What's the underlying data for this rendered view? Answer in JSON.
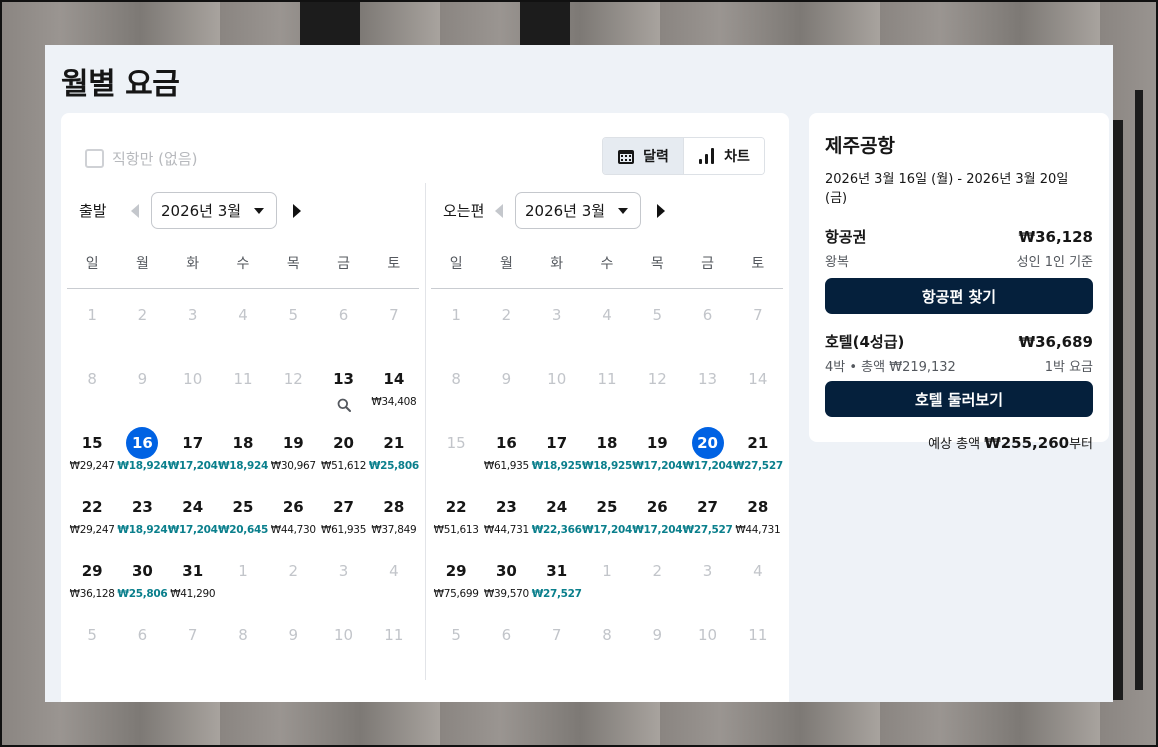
{
  "page_title": "월별 요금",
  "direct_only_label": "직항만 (없음)",
  "view_toggle": {
    "calendar": "달력",
    "chart": "차트",
    "active": "calendar"
  },
  "weekdays": [
    "일",
    "월",
    "화",
    "수",
    "목",
    "금",
    "토"
  ],
  "departure": {
    "label": "출발",
    "month_select": "2026년 3월",
    "weeks": [
      [
        {
          "d": "1",
          "m": true
        },
        {
          "d": "2",
          "m": true
        },
        {
          "d": "3",
          "m": true
        },
        {
          "d": "4",
          "m": true
        },
        {
          "d": "5",
          "m": true
        },
        {
          "d": "6",
          "m": true
        },
        {
          "d": "7",
          "m": true
        }
      ],
      [
        {
          "d": "8",
          "m": true
        },
        {
          "d": "9",
          "m": true
        },
        {
          "d": "10",
          "m": true
        },
        {
          "d": "11",
          "m": true
        },
        {
          "d": "12",
          "m": true
        },
        {
          "d": "13",
          "search": true
        },
        {
          "d": "14",
          "p": "₩34,408"
        }
      ],
      [
        {
          "d": "15",
          "p": "₩29,247"
        },
        {
          "d": "16",
          "p": "₩18,924",
          "low": true,
          "sel": true
        },
        {
          "d": "17",
          "p": "₩17,204",
          "low": true
        },
        {
          "d": "18",
          "p": "₩18,924",
          "low": true
        },
        {
          "d": "19",
          "p": "₩30,967"
        },
        {
          "d": "20",
          "p": "₩51,612"
        },
        {
          "d": "21",
          "p": "₩25,806",
          "low": true
        }
      ],
      [
        {
          "d": "22",
          "p": "₩29,247"
        },
        {
          "d": "23",
          "p": "₩18,924",
          "low": true
        },
        {
          "d": "24",
          "p": "₩17,204",
          "low": true
        },
        {
          "d": "25",
          "p": "₩20,645",
          "low": true
        },
        {
          "d": "26",
          "p": "₩44,730"
        },
        {
          "d": "27",
          "p": "₩61,935"
        },
        {
          "d": "28",
          "p": "₩37,849"
        }
      ],
      [
        {
          "d": "29",
          "p": "₩36,128"
        },
        {
          "d": "30",
          "p": "₩25,806",
          "low": true
        },
        {
          "d": "31",
          "p": "₩41,290"
        },
        {
          "d": "1",
          "m": true
        },
        {
          "d": "2",
          "m": true
        },
        {
          "d": "3",
          "m": true
        },
        {
          "d": "4",
          "m": true
        }
      ],
      [
        {
          "d": "5",
          "m": true
        },
        {
          "d": "6",
          "m": true
        },
        {
          "d": "7",
          "m": true
        },
        {
          "d": "8",
          "m": true
        },
        {
          "d": "9",
          "m": true
        },
        {
          "d": "10",
          "m": true
        },
        {
          "d": "11",
          "m": true
        }
      ]
    ]
  },
  "return": {
    "label": "오는편",
    "month_select": "2026년 3월",
    "weeks": [
      [
        {
          "d": "1",
          "m": true
        },
        {
          "d": "2",
          "m": true
        },
        {
          "d": "3",
          "m": true
        },
        {
          "d": "4",
          "m": true
        },
        {
          "d": "5",
          "m": true
        },
        {
          "d": "6",
          "m": true
        },
        {
          "d": "7",
          "m": true
        }
      ],
      [
        {
          "d": "8",
          "m": true
        },
        {
          "d": "9",
          "m": true
        },
        {
          "d": "10",
          "m": true
        },
        {
          "d": "11",
          "m": true
        },
        {
          "d": "12",
          "m": true
        },
        {
          "d": "13",
          "m": true
        },
        {
          "d": "14",
          "m": true
        }
      ],
      [
        {
          "d": "15",
          "m": true
        },
        {
          "d": "16",
          "p": "₩61,935"
        },
        {
          "d": "17",
          "p": "₩18,925",
          "low": true
        },
        {
          "d": "18",
          "p": "₩18,925",
          "low": true
        },
        {
          "d": "19",
          "p": "₩17,204",
          "low": true
        },
        {
          "d": "20",
          "p": "₩17,204",
          "low": true,
          "sel": true
        },
        {
          "d": "21",
          "p": "₩27,527",
          "low": true
        }
      ],
      [
        {
          "d": "22",
          "p": "₩51,613"
        },
        {
          "d": "23",
          "p": "₩44,731"
        },
        {
          "d": "24",
          "p": "₩22,366",
          "low": true
        },
        {
          "d": "25",
          "p": "₩17,204",
          "low": true
        },
        {
          "d": "26",
          "p": "₩17,204",
          "low": true
        },
        {
          "d": "27",
          "p": "₩27,527",
          "low": true
        },
        {
          "d": "28",
          "p": "₩44,731"
        }
      ],
      [
        {
          "d": "29",
          "p": "₩75,699"
        },
        {
          "d": "30",
          "p": "₩39,570"
        },
        {
          "d": "31",
          "p": "₩27,527",
          "low": true
        },
        {
          "d": "1",
          "m": true
        },
        {
          "d": "2",
          "m": true
        },
        {
          "d": "3",
          "m": true
        },
        {
          "d": "4",
          "m": true
        }
      ],
      [
        {
          "d": "5",
          "m": true
        },
        {
          "d": "6",
          "m": true
        },
        {
          "d": "7",
          "m": true
        },
        {
          "d": "8",
          "m": true
        },
        {
          "d": "9",
          "m": true
        },
        {
          "d": "10",
          "m": true
        },
        {
          "d": "11",
          "m": true
        }
      ]
    ]
  },
  "summary": {
    "destination": "제주공항",
    "dates": "2026년 3월 16일 (월) - 2026년 3월 20일 (금)",
    "flight": {
      "label": "항공권",
      "price": "₩36,128",
      "sub_left": "왕복",
      "sub_right": "성인 1인 기준",
      "button": "항공편 찾기"
    },
    "hotel": {
      "label": "호텔(4성급)",
      "price": "₩36,689",
      "sub_left": "4박 • 총액 ₩219,132",
      "sub_right": "1박 요금",
      "button": "호텔 둘러보기"
    },
    "total_prefix": "예상 총액",
    "total_value": "₩255,260",
    "total_suffix": "부터"
  },
  "colors": {
    "selected": "#0062e3",
    "low_price": "#0a7f8c",
    "cta": "#05203c"
  }
}
